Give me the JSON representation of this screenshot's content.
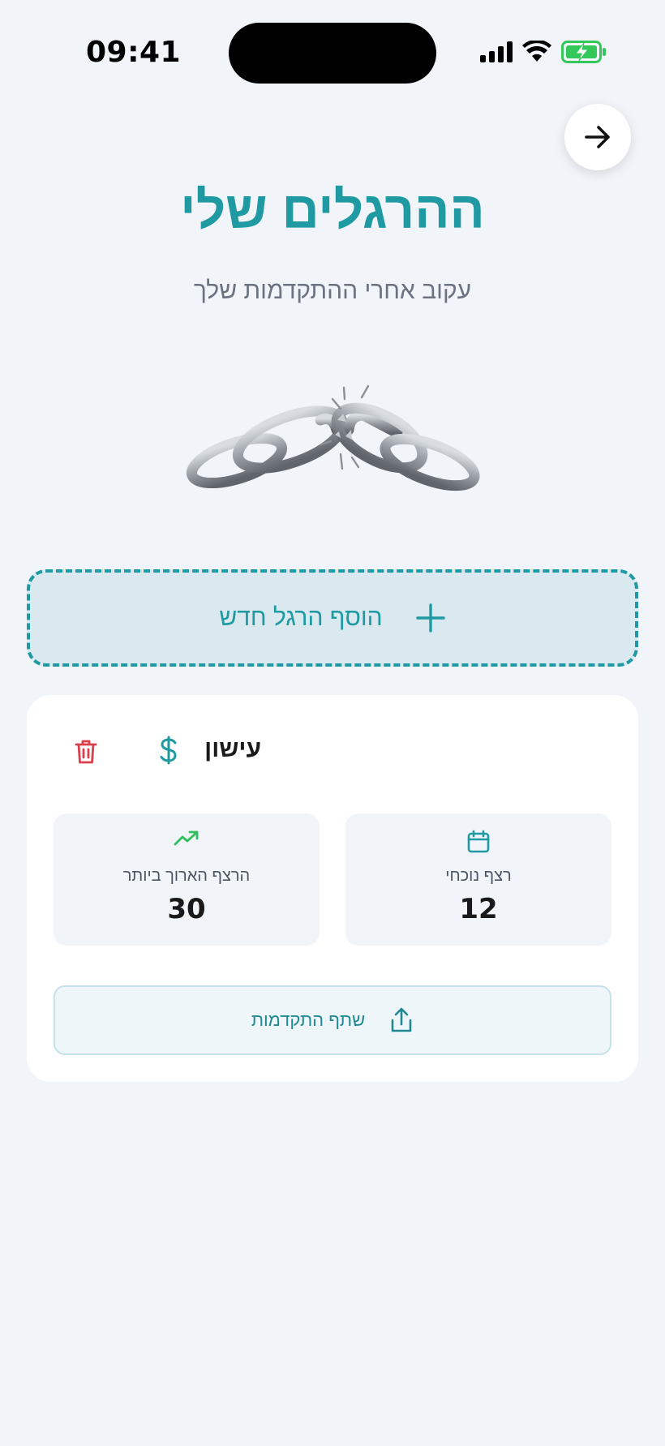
{
  "status_bar": {
    "time": "09:41",
    "icons": [
      "signal-icon",
      "wifi-icon",
      "battery-charging-icon"
    ]
  },
  "header": {
    "back_icon": "arrow-right-icon",
    "title": "ההרגלים שלי",
    "subtitle": "עקוב אחרי ההתקדמות שלך"
  },
  "illustration": {
    "name": "broken-chain-image"
  },
  "add_habit": {
    "label": "הוסף הרגל חדש",
    "icon": "plus-icon"
  },
  "habit": {
    "name": "עישון",
    "category_icon": "dollar-icon",
    "delete_icon": "trash-icon",
    "stats": {
      "current_streak": {
        "label": "רצף נוכחי",
        "value": "12",
        "icon": "calendar-icon"
      },
      "longest_streak": {
        "label": "הרצף הארוך ביותר",
        "value": "30",
        "icon": "trending-up-icon"
      }
    },
    "share": {
      "label": "שתף התקדמות",
      "icon": "share-icon"
    }
  },
  "colors": {
    "accent": "#1f9aa3",
    "background": "#f1f4f9",
    "delete": "#d9404a",
    "trend": "#2fbf5a",
    "battery": "#34c759"
  }
}
